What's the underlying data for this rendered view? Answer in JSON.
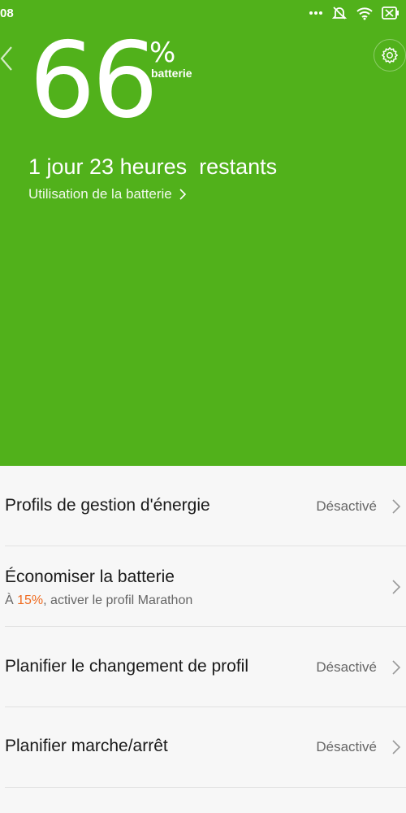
{
  "status_bar": {
    "time": "08",
    "icons": [
      "more-icon",
      "notifications-off-icon",
      "wifi-icon",
      "battery-x-icon"
    ]
  },
  "hero": {
    "battery_percent": "66",
    "percent_sign": "%",
    "percent_label": "batterie",
    "remaining_text": "1 jour 23 heures  restants",
    "usage_link": "Utilisation de la batterie",
    "background_color": "#51b11b"
  },
  "list": {
    "items": [
      {
        "title": "Profils de gestion d'énergie",
        "value": "Désactivé"
      },
      {
        "title": "Économiser la batterie",
        "subtitle_prefix": "À ",
        "subtitle_accent": "15%",
        "subtitle_suffix": ", activer le profil Marathon"
      },
      {
        "title": "Planifier le changement de profil",
        "value": "Désactivé"
      },
      {
        "title": "Planifier marche/arrêt",
        "value": "Désactivé"
      }
    ],
    "accent_color": "#ef6a1e"
  }
}
